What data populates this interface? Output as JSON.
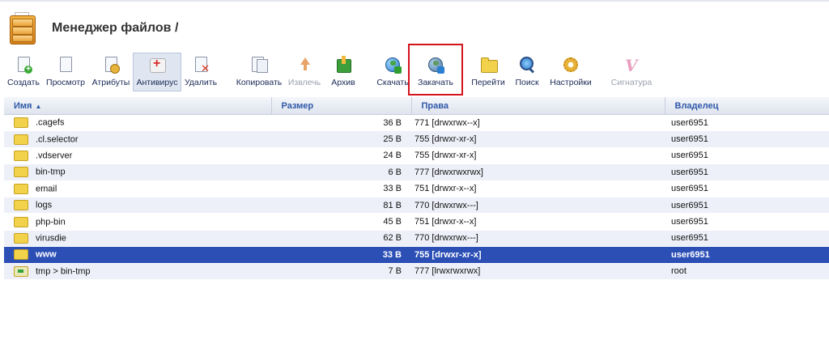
{
  "header": {
    "title": "Менеджер файлов /"
  },
  "toolbar": [
    {
      "label": "Создать",
      "icon": "new-file-icon",
      "state": "normal"
    },
    {
      "label": "Просмотр",
      "icon": "view-icon",
      "state": "normal"
    },
    {
      "label": "Атрибуты",
      "icon": "attributes-icon",
      "state": "normal"
    },
    {
      "label": "Антивирус",
      "icon": "antivirus-icon",
      "state": "active"
    },
    {
      "label": "Удалить",
      "icon": "delete-icon",
      "state": "normal"
    },
    {
      "label": "Копировать",
      "icon": "copy-icon",
      "state": "normal"
    },
    {
      "label": "Извлечь",
      "icon": "extract-icon",
      "state": "disabled"
    },
    {
      "label": "Архив",
      "icon": "archive-icon",
      "state": "normal"
    },
    {
      "label": "Скачать",
      "icon": "download-icon",
      "state": "normal"
    },
    {
      "label": "Закачать",
      "icon": "upload-icon",
      "state": "highlighted"
    },
    {
      "label": "Перейти",
      "icon": "folder-icon",
      "state": "normal"
    },
    {
      "label": "Поиск",
      "icon": "search-icon",
      "state": "normal"
    },
    {
      "label": "Настройки",
      "icon": "settings-icon",
      "state": "normal"
    },
    {
      "label": "Сигнатура",
      "icon": "signature-icon",
      "state": "disabled"
    }
  ],
  "table": {
    "columns": {
      "name": "Имя",
      "size": "Размер",
      "perms": "Права",
      "owner": "Владелец"
    },
    "sort_indicator": "▲",
    "rows": [
      {
        "name": ".cagefs",
        "size": "36 B",
        "perms": "771 [drwxrwx--x]",
        "owner": "user6951",
        "type": "folder"
      },
      {
        "name": ".cl.selector",
        "size": "25 B",
        "perms": "755 [drwxr-xr-x]",
        "owner": "user6951",
        "type": "folder"
      },
      {
        "name": ".vdserver",
        "size": "24 B",
        "perms": "755 [drwxr-xr-x]",
        "owner": "user6951",
        "type": "folder"
      },
      {
        "name": "bin-tmp",
        "size": "6 B",
        "perms": "777 [drwxrwxrwx]",
        "owner": "user6951",
        "type": "folder"
      },
      {
        "name": "email",
        "size": "33 B",
        "perms": "751 [drwxr-x--x]",
        "owner": "user6951",
        "type": "folder"
      },
      {
        "name": "logs",
        "size": "81 B",
        "perms": "770 [drwxrwx---]",
        "owner": "user6951",
        "type": "folder"
      },
      {
        "name": "php-bin",
        "size": "45 B",
        "perms": "751 [drwxr-x--x]",
        "owner": "user6951",
        "type": "folder"
      },
      {
        "name": "virusdie",
        "size": "62 B",
        "perms": "770 [drwxrwx---]",
        "owner": "user6951",
        "type": "folder"
      },
      {
        "name": "www",
        "size": "33 B",
        "perms": "755 [drwxr-xr-x]",
        "owner": "user6951",
        "type": "folder",
        "selected": true
      },
      {
        "name": "tmp > bin-tmp",
        "size": "7 B",
        "perms": "777 [lrwxrwxrwx]",
        "owner": "root",
        "type": "link"
      }
    ]
  },
  "colors": {
    "selected_row": "#2c4fb6",
    "header_text": "#2f58a8",
    "highlight_box": "#d4141b"
  }
}
